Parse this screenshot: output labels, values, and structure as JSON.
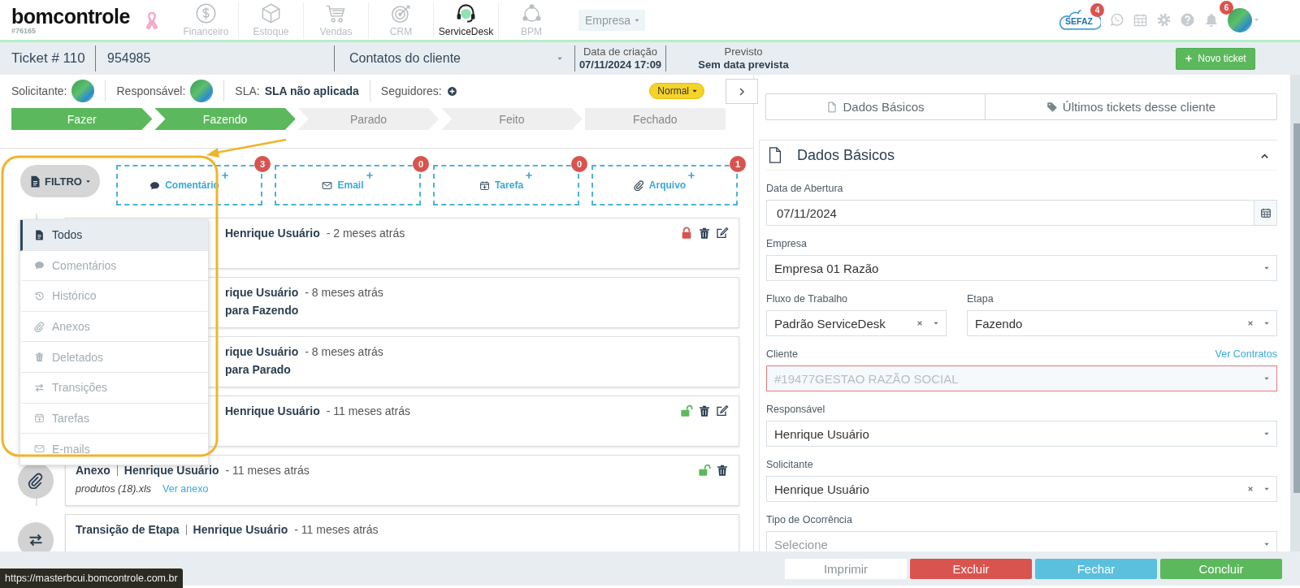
{
  "topbar": {
    "logo": "bomcontrole",
    "account": "#76165",
    "modules": [
      {
        "label": "Financeiro",
        "kind": "dollar",
        "selected": false
      },
      {
        "label": "Estoque",
        "kind": "box",
        "selected": false
      },
      {
        "label": "Vendas",
        "kind": "cart",
        "selected": false
      },
      {
        "label": "CRM",
        "kind": "target",
        "selected": false
      },
      {
        "label": "ServiceDesk",
        "kind": "headset",
        "selected": true
      },
      {
        "label": "BPM",
        "kind": "network",
        "selected": false
      }
    ],
    "company_select": {
      "value": "Empresa",
      "disabled": true
    },
    "sefaz": {
      "label": "SEFAZ",
      "count": "4"
    },
    "notifications": {
      "count": "6"
    }
  },
  "ticket": {
    "number": "Ticket # 110",
    "code": "954985",
    "contact_select": "Contatos do cliente",
    "created_label": "Data de criação",
    "created_value": "07/11/2024 17:09",
    "due_label": "Previsto",
    "due_value": "Sem data prevista",
    "new_button": "Novo ticket"
  },
  "info_row": {
    "requester_label": "Solicitante:",
    "responsible_label": "Responsável:",
    "sla_label": "SLA:",
    "sla_value": "SLA não aplicada",
    "followers_label": "Seguidores:",
    "priority": "Normal"
  },
  "stages": [
    {
      "label": "Fazer",
      "reached": true
    },
    {
      "label": "Fazendo",
      "reached": true
    },
    {
      "label": "Parado",
      "reached": false
    },
    {
      "label": "Feito",
      "reached": false
    },
    {
      "label": "Fechado",
      "reached": false
    }
  ],
  "filter_button": "FILTRO",
  "actions": [
    {
      "label": "Comentário",
      "kind": "comment",
      "count": "3"
    },
    {
      "label": "Email",
      "kind": "email",
      "count": "0"
    },
    {
      "label": "Tarefa",
      "kind": "task",
      "count": "0"
    },
    {
      "label": "Arquivo",
      "kind": "attachment",
      "count": "1"
    }
  ],
  "filter_menu": [
    {
      "label": "Todos",
      "kind": "all",
      "selected": true
    },
    {
      "label": "Comentários",
      "kind": "comment",
      "selected": false
    },
    {
      "label": "Histórico",
      "kind": "history",
      "selected": false
    },
    {
      "label": "Anexos",
      "kind": "attachment",
      "selected": false
    },
    {
      "label": "Deletados",
      "kind": "trash",
      "selected": false
    },
    {
      "label": "Transições",
      "kind": "transfer",
      "selected": false
    },
    {
      "label": "Tarefas",
      "kind": "task",
      "selected": false
    },
    {
      "label": "E-mails",
      "kind": "email",
      "selected": false
    }
  ],
  "timeline": [
    {
      "author": "Henrique Usuário",
      "time": "- 2 meses atrás",
      "locked": true,
      "deletable": true,
      "editable": true
    },
    {
      "author": "rique Usuário",
      "time": "- 8 meses atrás",
      "body": "para Fazendo"
    },
    {
      "author": "rique Usuário",
      "time": "- 8 meses atrás",
      "body": "para Parado"
    },
    {
      "author": "Henrique Usuário",
      "time": "- 11 meses atrás",
      "locked": false,
      "deletable": true,
      "editable": true
    },
    {
      "kind": "attachment",
      "type": "Anexo",
      "author": "Henrique Usuário",
      "time": "- 11 meses atrás",
      "file": "produtos (18).xls",
      "link": "Ver anexo",
      "locked": false,
      "deletable": true,
      "editable": false
    },
    {
      "kind": "transfer",
      "type": "Transição de Etapa",
      "author": "Henrique Usuário",
      "time": "- 11 meses atrás"
    }
  ],
  "right_panel": {
    "tabs": [
      {
        "label": "Dados Básicos",
        "kind": "file",
        "selected": false
      },
      {
        "label": "Últimos tickets desse cliente",
        "kind": "tag",
        "selected": false
      }
    ],
    "section": {
      "title": "Dados Básicos",
      "expanded": true
    },
    "rows": [
      [
        {
          "label": "Data de Abertura",
          "value": "07/11/2024",
          "kind": "date"
        }
      ],
      [
        {
          "label": "Empresa",
          "value": "Empresa 01 Razão",
          "kind": "select"
        }
      ],
      [
        {
          "label": "Fluxo de Trabalho",
          "value": "Padrão ServiceDesk",
          "kind": "select",
          "clearable": true
        },
        {
          "label": "Etapa",
          "value": "Fazendo",
          "kind": "select",
          "clearable": true
        }
      ],
      [
        {
          "label": "Cliente",
          "value": "#19477GESTAO RAZÃO SOCIAL",
          "kind": "select",
          "disabled": true,
          "invalid": true,
          "link": "Ver Contratos"
        }
      ],
      [
        {
          "label": "Responsável",
          "value": "Henrique Usuário",
          "kind": "select"
        }
      ],
      [
        {
          "label": "Solicitante",
          "value": "Henrique Usuário",
          "kind": "select",
          "clearable": true
        }
      ],
      [
        {
          "label": "Tipo de Ocorrência",
          "placeholder": "Selecione",
          "kind": "select"
        }
      ]
    ]
  },
  "footer_buttons": [
    {
      "label": "Imprimir",
      "kind": "default"
    },
    {
      "label": "Excluir",
      "kind": "danger"
    },
    {
      "label": "Fechar",
      "kind": "info"
    },
    {
      "label": "Concluir",
      "kind": "success"
    }
  ],
  "status_url": "https://masterbcui.bomcontrole.com.br"
}
